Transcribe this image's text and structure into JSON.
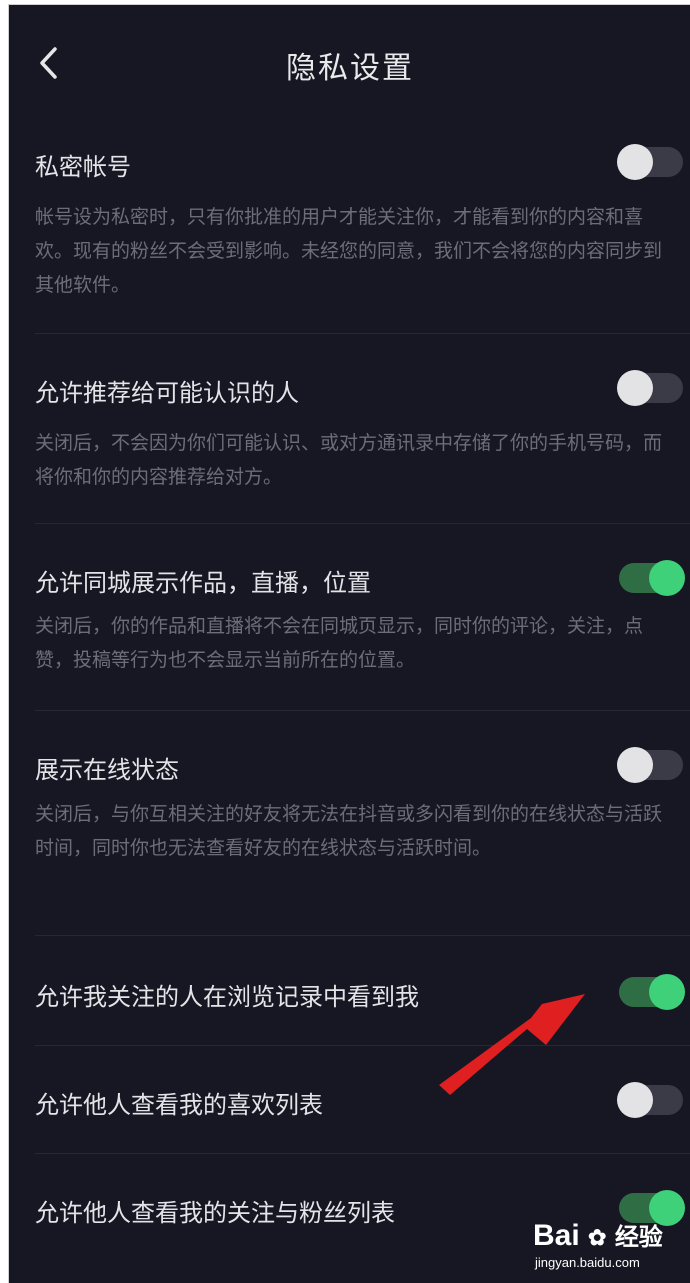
{
  "header": {
    "title": "隐私设置"
  },
  "settings": [
    {
      "label": "私密帐号",
      "desc": "帐号设为私密时，只有你批准的用户才能关注你，才能看到你的内容和喜欢。现有的粉丝不会受到影响。未经您的同意，我们不会将您的内容同步到其他软件。",
      "enabled": false
    },
    {
      "label": "允许推荐给可能认识的人",
      "desc": "关闭后，不会因为你们可能认识、或对方通讯录中存储了你的手机号码，而将你和你的内容推荐给对方。",
      "enabled": false
    },
    {
      "label": "允许同城展示作品，直播，位置",
      "desc": "关闭后，你的作品和直播将不会在同城页显示，同时你的评论，关注，点赞，投稿等行为也不会显示当前所在的位置。",
      "enabled": true
    },
    {
      "label": "展示在线状态",
      "desc": "关闭后，与你互相关注的好友将无法在抖音或多闪看到你的在线状态与活跃时间，同时你也无法查看好友的在线状态与活跃时间。",
      "enabled": false
    },
    {
      "label": "允许我关注的人在浏览记录中看到我",
      "desc": "",
      "enabled": true
    },
    {
      "label": "允许他人查看我的喜欢列表",
      "desc": "",
      "enabled": false
    },
    {
      "label": "允许他人查看我的关注与粉丝列表",
      "desc": "",
      "enabled": true
    }
  ],
  "watermark": {
    "brand_a": "Bai",
    "brand_b": "经验",
    "url": "jingyan.baidu.com"
  },
  "colors": {
    "background": "#161722",
    "toggle_on": "#3fd07a",
    "annotation_arrow": "#e02020"
  }
}
